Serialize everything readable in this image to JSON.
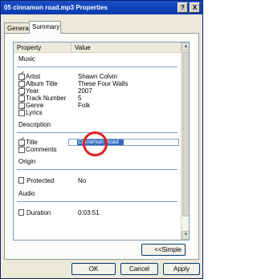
{
  "window": {
    "title": "05 cinnamon road.mp3 Properties",
    "help_label": "?",
    "close_label": "X"
  },
  "tabs": [
    {
      "label": "General"
    },
    {
      "label": "Summary"
    }
  ],
  "table": {
    "headers": {
      "property": "Property",
      "value": "Value"
    },
    "groups": {
      "music": "Music",
      "description": "Description",
      "origin": "Origin",
      "audio": "Audio"
    },
    "music_rows": [
      {
        "property": "Artist",
        "value": "Shawn Colvin"
      },
      {
        "property": "Album Title",
        "value": "These Four Walls"
      },
      {
        "property": "Year",
        "value": "2007"
      },
      {
        "property": "Track Number",
        "value": "5"
      },
      {
        "property": "Genre",
        "value": "Folk"
      },
      {
        "property": "Lyrics",
        "value": ""
      }
    ],
    "description_rows": [
      {
        "property": "Title",
        "value": "Cinnamon Road"
      },
      {
        "property": "Comments",
        "value": ""
      }
    ],
    "origin_rows": [
      {
        "property": "Protected",
        "value": "No"
      }
    ],
    "audio_rows": [
      {
        "property": "Duration",
        "value": "0:03:51"
      }
    ]
  },
  "buttons": {
    "simple": "<<Simple",
    "ok": "OK",
    "cancel": "Cancel",
    "apply": "Apply"
  },
  "colors": {
    "titlebar": "#0a3bb0",
    "selection": "#316ac5",
    "marker": "#e02020"
  }
}
